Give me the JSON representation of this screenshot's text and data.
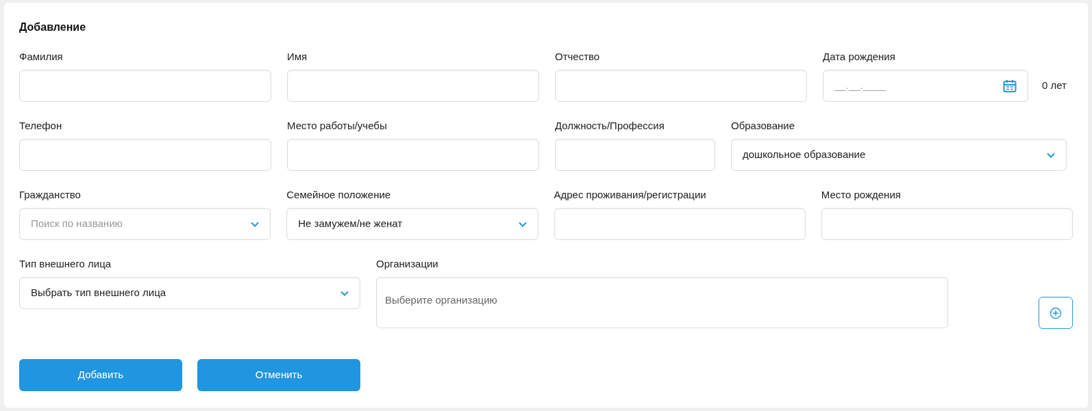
{
  "title": "Добавление",
  "rows": [
    [
      {
        "kind": "text",
        "label": "Фамилия"
      },
      {
        "kind": "text",
        "label": "Имя"
      },
      {
        "kind": "text",
        "label": "Отчество"
      },
      {
        "kind": "date",
        "label": "Дата рождения",
        "placeholder": "__.__.____",
        "age": "0 лет"
      }
    ],
    [
      {
        "kind": "text",
        "label": "Телефон"
      },
      {
        "kind": "text",
        "label": "Место работы/учебы"
      },
      {
        "kind": "text",
        "label": "Должность/Профессия"
      },
      {
        "kind": "select",
        "label": "Образование",
        "value": "дошкольное образование"
      }
    ],
    [
      {
        "kind": "select",
        "label": "Гражданство",
        "placeholder": "Поиск по названию"
      },
      {
        "kind": "select",
        "label": "Семейное положение",
        "value": "Не замужем/не женат"
      },
      {
        "kind": "text",
        "label": "Адрес проживания/регистрации"
      },
      {
        "kind": "text",
        "label": "Место рождения"
      }
    ]
  ],
  "person_type": {
    "label": "Тип внешнего лица",
    "value": "Выбрать тип внешнего лица"
  },
  "organizations": {
    "label": "Организации",
    "placeholder": "Выберите организацию"
  },
  "buttons": [
    "Добавить",
    "Отменить"
  ]
}
